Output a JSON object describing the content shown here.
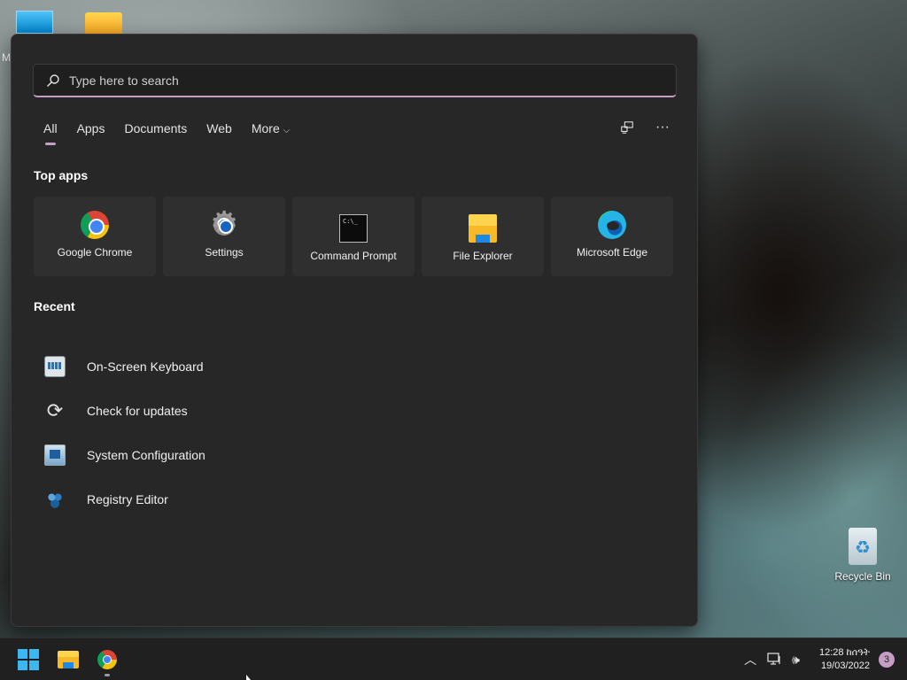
{
  "desktop": {
    "partial_label": "M",
    "recycle_bin_label": "Recycle Bin"
  },
  "search": {
    "placeholder": "Type here to search",
    "value": ""
  },
  "tabs": [
    {
      "label": "All",
      "active": true
    },
    {
      "label": "Apps"
    },
    {
      "label": "Documents"
    },
    {
      "label": "Web"
    },
    {
      "label": "More"
    }
  ],
  "tools": {
    "share_icon": "share-window-icon",
    "more_icon": "ellipsis-icon",
    "more_glyph": "···"
  },
  "top_apps": {
    "title": "Top apps",
    "items": [
      {
        "name": "Google Chrome",
        "icon": "chrome-icon"
      },
      {
        "name": "Settings",
        "icon": "settings-gear-icon"
      },
      {
        "name": "Command Prompt",
        "icon": "command-prompt-icon"
      },
      {
        "name": "File Explorer",
        "icon": "folder-icon"
      },
      {
        "name": "Microsoft Edge",
        "icon": "edge-icon"
      }
    ]
  },
  "recent": {
    "title": "Recent",
    "items": [
      {
        "name": "On-Screen Keyboard",
        "icon": "keyboard-icon"
      },
      {
        "name": "Check for updates",
        "icon": "refresh-icon"
      },
      {
        "name": "System Configuration",
        "icon": "system-config-icon"
      },
      {
        "name": "Registry Editor",
        "icon": "registry-icon"
      }
    ]
  },
  "taskbar": {
    "pinned": [
      "start-icon",
      "file-explorer-icon",
      "chrome-icon"
    ],
    "tray": {
      "time": "12:28 ከሰዓት",
      "date": "19/03/2022",
      "notification_count": "3"
    }
  },
  "colors": {
    "accent": "#c59ec5",
    "panel_bg": "#272727",
    "tile_bg": "#2f2f2f",
    "taskbar_bg": "#202020"
  }
}
